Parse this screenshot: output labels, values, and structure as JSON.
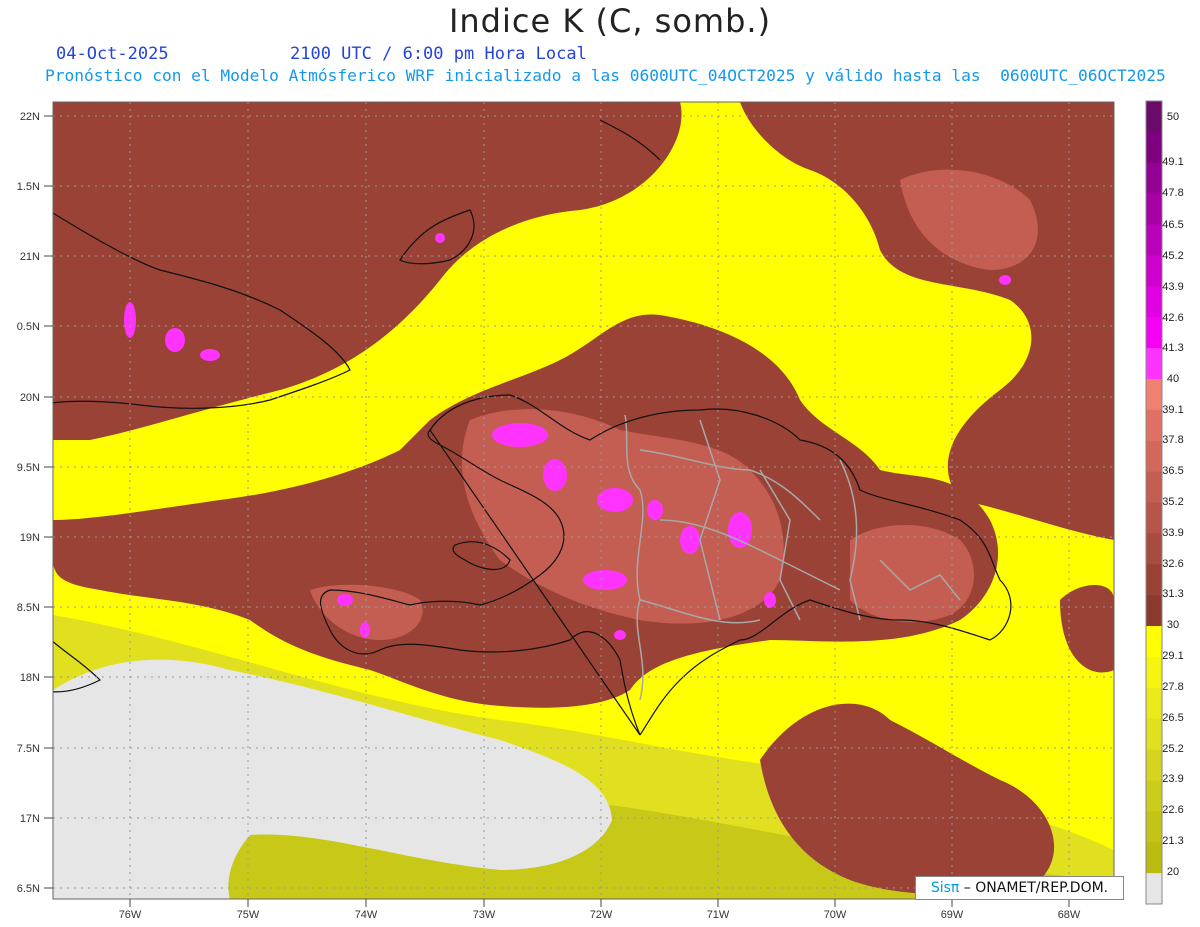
{
  "header": {
    "title": "Indice K (C, somb.)",
    "date": "04-Oct-2025",
    "time": "2100 UTC / 6:00 pm Hora Local",
    "description": "Pronóstico con el Modelo Atmósferico WRF inicializado a las 0600UTC_04OCT2025 y válido hasta las  0600UTC_06OCT2025"
  },
  "axes": {
    "lat_labels": [
      "22N",
      "1.5N",
      "21N",
      "0.5N",
      "20N",
      "9.5N",
      "19N",
      "8.5N",
      "18N",
      "7.5N",
      "17N",
      "6.5N"
    ],
    "lon_labels": [
      "76W",
      "75W",
      "74W",
      "73W",
      "72W",
      "71W",
      "70W",
      "69W",
      "68W"
    ]
  },
  "colorbar": {
    "labels": [
      "50",
      "49.1",
      "47.8",
      "46.5",
      "45.2",
      "43.9",
      "42.6",
      "41.3",
      "40",
      "39.1",
      "37.8",
      "36.5",
      "35.2",
      "33.9",
      "32.6",
      "31.3",
      "30",
      "29.1",
      "27.8",
      "26.5",
      "25.2",
      "23.9",
      "22.6",
      "21.3",
      "20"
    ],
    "colors": [
      "#6a0a6a",
      "#7f007f",
      "#930093",
      "#a600a6",
      "#ba00ba",
      "#cd00cd",
      "#e100e1",
      "#f500f5",
      "#ff33ff",
      "#f08070",
      "#e07065",
      "#d2685a",
      "#c55e52",
      "#b8554a",
      "#a84b40",
      "#9a4236",
      "#8a3a2e",
      "#ffff00",
      "#f5f510",
      "#eaea1a",
      "#e0e020",
      "#d5d520",
      "#cccc1c",
      "#c3c318",
      "#bbbb12",
      "#e6e6e6"
    ]
  },
  "footer": {
    "logo": "Sisπ",
    "org": " – ONAMET/REP.DOM."
  }
}
